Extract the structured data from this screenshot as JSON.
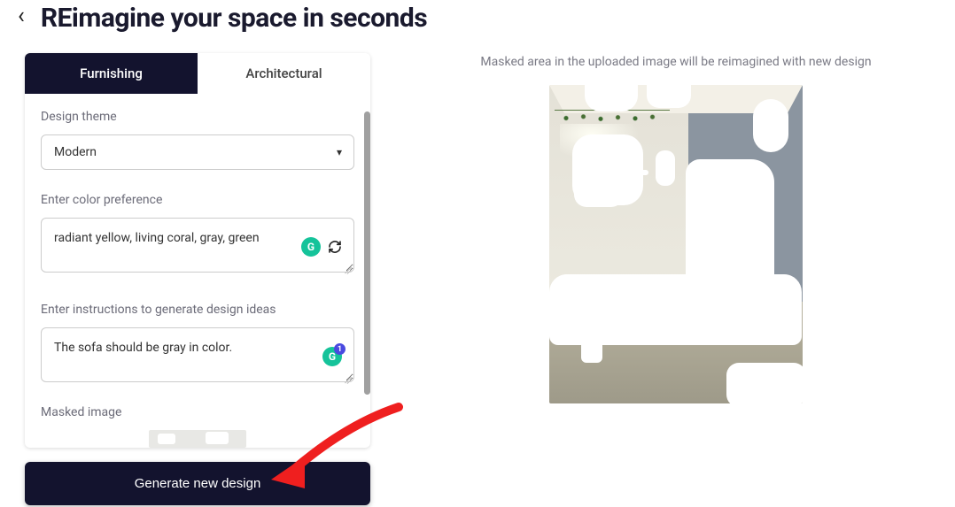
{
  "header": {
    "title": "REimagine your space in seconds"
  },
  "tabs": {
    "furnishing": "Furnishing",
    "architectural": "Architectural"
  },
  "form": {
    "theme_label": "Design theme",
    "theme_value": "Modern",
    "color_label": "Enter color preference",
    "color_value": "radiant yellow, living coral, gray, green",
    "instructions_label": "Enter instructions to generate design ideas",
    "instructions_value": "The sofa should be gray in color.",
    "masked_label": "Masked image",
    "grammarly_count": "1"
  },
  "actions": {
    "generate": "Generate new design"
  },
  "preview": {
    "hint": "Masked area in the uploaded image will be reimagined with new design"
  }
}
